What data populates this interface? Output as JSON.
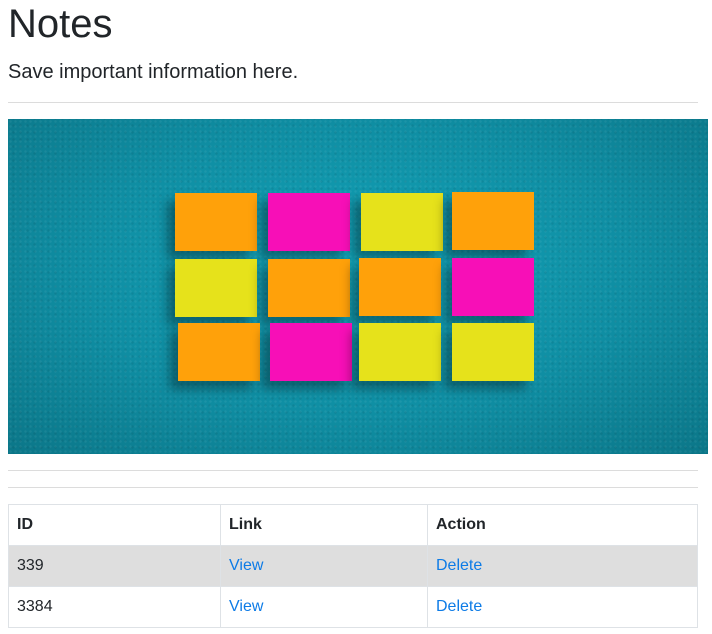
{
  "header": {
    "title": "Notes",
    "subtitle": "Save important information here."
  },
  "hero": {
    "image": "sticky-notes-on-teal-wall",
    "note_colors": [
      "#ffa10a",
      "#f70fb7",
      "#e6e21b"
    ],
    "background_color": "#0f8ea3"
  },
  "table": {
    "headers": {
      "id": "ID",
      "link": "Link",
      "action": "Action"
    },
    "rows": [
      {
        "id": "339",
        "link": "View",
        "action": "Delete"
      },
      {
        "id": "3384",
        "link": "View",
        "action": "Delete"
      }
    ]
  },
  "colors": {
    "link": "#0d7be6",
    "striped_row": "#dedede"
  }
}
